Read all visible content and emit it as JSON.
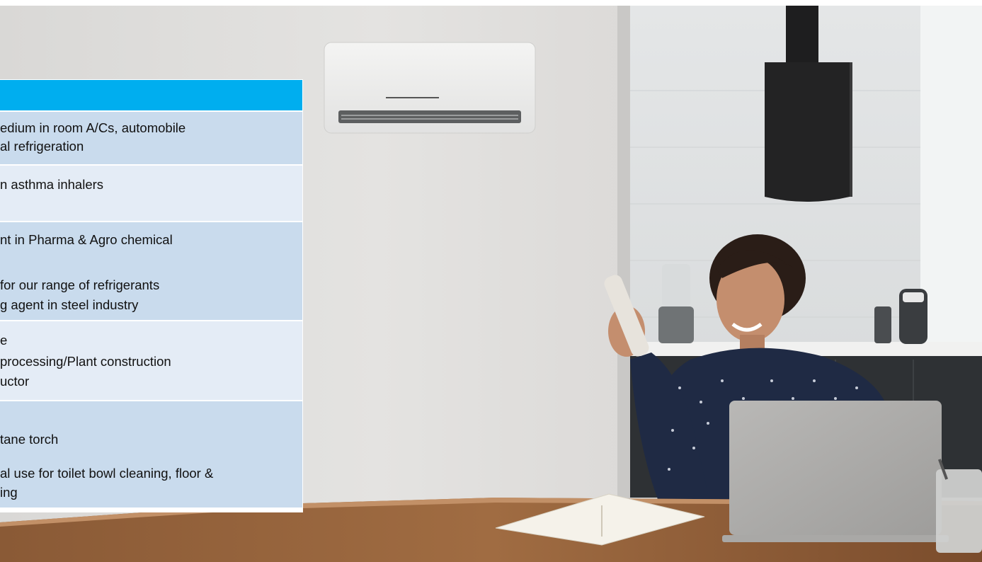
{
  "table": {
    "header_color": "#00aeef",
    "row_colors": [
      "#c9dbed",
      "#e4ecf6"
    ],
    "rows": [
      {
        "lines": [
          "edium in room A/Cs, automobile",
          "al refrigeration"
        ]
      },
      {
        "lines": [
          "n asthma inhalers"
        ]
      },
      {
        "lines": [
          "nt in Pharma & Agro chemical",
          "",
          "for our range of refrigerants",
          "g agent in steel industry"
        ]
      },
      {
        "lines": [
          "e",
          "processing/Plant construction",
          "uctor"
        ]
      },
      {
        "lines": [
          "",
          "tane torch",
          "al use for toilet bowl cleaning, floor &",
          "ing"
        ]
      }
    ]
  },
  "photo": {
    "subject": "woman-using-ac-remote",
    "objects": [
      "air-conditioner",
      "range-hood",
      "laptop",
      "notebook",
      "blender",
      "pen-cup",
      "coffee-machine"
    ]
  }
}
